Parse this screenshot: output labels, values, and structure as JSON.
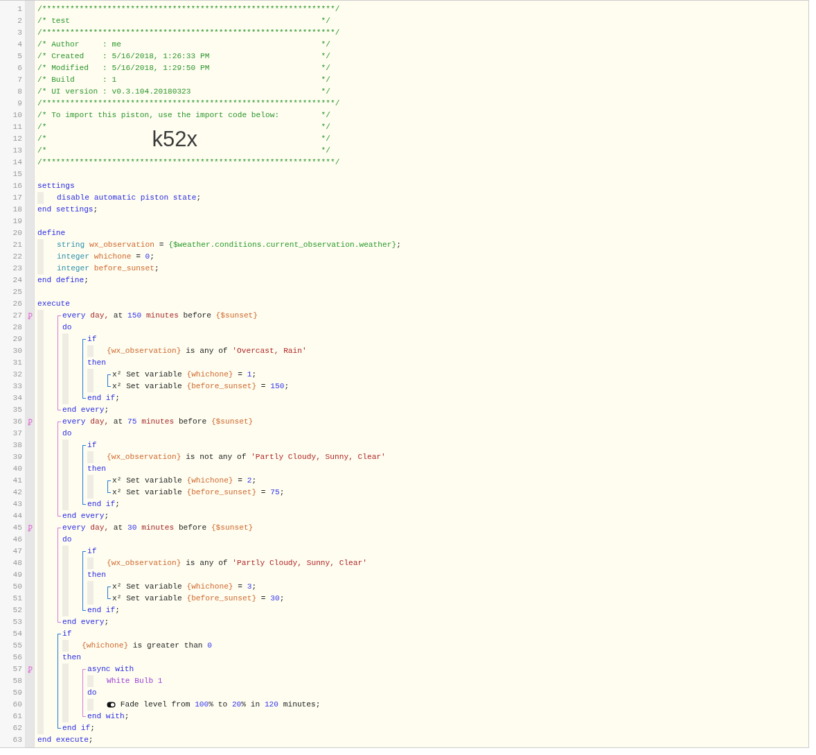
{
  "code": [
    {
      "kind": "line",
      "number": "1",
      "tokens": [
        {
          "kind": "comment",
          "text": "/***************************************************************/"
        }
      ]
    },
    {
      "kind": "line",
      "number": "2",
      "tokens": [
        {
          "kind": "comment",
          "text": "/* test"
        },
        {
          "kind": "comment-end",
          "text": "*/"
        }
      ]
    },
    {
      "kind": "line",
      "number": "3",
      "tokens": [
        {
          "kind": "comment",
          "text": "/***************************************************************/"
        }
      ]
    },
    {
      "kind": "line",
      "number": "4",
      "tokens": [
        {
          "kind": "comment",
          "text": "/* Author     : me"
        },
        {
          "kind": "comment-end",
          "text": "*/"
        }
      ]
    },
    {
      "kind": "line",
      "number": "5",
      "tokens": [
        {
          "kind": "comment",
          "text": "/* Created    : 5/16/2018, 1:26:33 PM"
        },
        {
          "kind": "comment-end",
          "text": "*/"
        }
      ]
    },
    {
      "kind": "line",
      "number": "6",
      "tokens": [
        {
          "kind": "comment",
          "text": "/* Modified   : 5/16/2018, 1:29:50 PM"
        },
        {
          "kind": "comment-end",
          "text": "*/"
        }
      ]
    },
    {
      "kind": "line",
      "number": "7",
      "tokens": [
        {
          "kind": "comment",
          "text": "/* Build      : 1"
        },
        {
          "kind": "comment-end",
          "text": "*/"
        }
      ]
    },
    {
      "kind": "line",
      "number": "8",
      "tokens": [
        {
          "kind": "comment",
          "text": "/* UI version : v0.3.104.20180323"
        },
        {
          "kind": "comment-end",
          "text": "*/"
        }
      ]
    },
    {
      "kind": "line",
      "number": "9",
      "tokens": [
        {
          "kind": "comment",
          "text": "/***************************************************************/"
        }
      ]
    },
    {
      "kind": "line",
      "number": "10",
      "tokens": [
        {
          "kind": "comment",
          "text": "/* To import this piston, use the import code below:"
        },
        {
          "kind": "comment-end",
          "text": "*/"
        }
      ]
    },
    {
      "kind": "line",
      "number": "11",
      "tokens": [
        {
          "kind": "comment",
          "text": "/*"
        },
        {
          "kind": "comment-end",
          "text": "*/"
        }
      ]
    },
    {
      "kind": "line",
      "number": "12",
      "tokens": [
        {
          "kind": "comment",
          "text": "/*"
        },
        {
          "kind": "import-code",
          "text": "k52x"
        },
        {
          "kind": "comment-end",
          "text": "*/"
        }
      ]
    },
    {
      "kind": "line",
      "number": "13",
      "tokens": [
        {
          "kind": "comment",
          "text": "/*"
        },
        {
          "kind": "comment-end",
          "text": "*/"
        }
      ]
    },
    {
      "kind": "line",
      "number": "14",
      "tokens": [
        {
          "kind": "comment",
          "text": "/***************************************************************/"
        }
      ]
    },
    {
      "kind": "line",
      "number": "15"
    },
    {
      "kind": "line",
      "number": "16",
      "tokens": [
        {
          "kind": "keyword",
          "text": "settings"
        }
      ],
      "children": [
        {
          "kind": "line",
          "number": "17",
          "tokens": [
            {
              "kind": "keyword",
              "text": "disable automatic piston state"
            },
            {
              "kind": "plain",
              "text": ";"
            }
          ]
        }
      ]
    },
    {
      "kind": "line",
      "number": "18",
      "tokens": [
        {
          "kind": "keyword",
          "text": "end settings"
        },
        {
          "kind": "plain",
          "text": ";"
        }
      ]
    },
    {
      "kind": "line",
      "number": "19"
    },
    {
      "kind": "line",
      "number": "20",
      "tokens": [
        {
          "kind": "keyword",
          "text": "define"
        }
      ],
      "children": [
        {
          "kind": "line",
          "number": "21",
          "tokens": [
            {
              "kind": "type",
              "text": "string"
            },
            {
              "kind": "variable",
              "text": " wx_observation"
            },
            {
              "kind": "plain",
              "text": " = "
            },
            {
              "kind": "expression",
              "text": "{$weather.conditions.current_observation.weather}"
            },
            {
              "kind": "plain",
              "text": ";"
            }
          ]
        },
        {
          "kind": "line",
          "number": "22",
          "tokens": [
            {
              "kind": "type",
              "text": "integer"
            },
            {
              "kind": "variable",
              "text": " whichone"
            },
            {
              "kind": "plain",
              "text": " = "
            },
            {
              "kind": "number",
              "text": "0"
            },
            {
              "kind": "plain",
              "text": ";"
            }
          ]
        },
        {
          "kind": "line",
          "number": "23",
          "tokens": [
            {
              "kind": "type",
              "text": "integer"
            },
            {
              "kind": "variable",
              "text": " before_sunset"
            },
            {
              "kind": "plain",
              "text": ";"
            }
          ]
        }
      ]
    },
    {
      "kind": "line",
      "number": "24",
      "tokens": [
        {
          "kind": "keyword",
          "text": "end define"
        },
        {
          "kind": "plain",
          "text": ";"
        }
      ]
    },
    {
      "kind": "line",
      "number": "25"
    },
    {
      "kind": "line",
      "number": "26",
      "tokens": [
        {
          "kind": "keyword",
          "text": "execute"
        }
      ],
      "children": [
        {
          "kind": "block",
          "color": "#d67ad9",
          "items": [
            {
              "kind": "line",
              "number": "27",
              "marker": true,
              "tokens": [
                {
                  "kind": "keyword",
                  "text": "every"
                },
                {
                  "kind": "unit",
                  "text": " day,"
                },
                {
                  "kind": "plain",
                  "text": " at "
                },
                {
                  "kind": "number",
                  "text": "150"
                },
                {
                  "kind": "unit",
                  "text": " minutes"
                },
                {
                  "kind": "plain",
                  "text": " before "
                },
                {
                  "kind": "variable",
                  "text": "{$sunset}"
                }
              ]
            },
            {
              "kind": "line",
              "number": "28",
              "tokens": [
                {
                  "kind": "keyword",
                  "text": "do"
                }
              ],
              "children": [
                {
                  "kind": "block",
                  "color": "#1f7ad8",
                  "items": [
                    {
                      "kind": "line",
                      "number": "29",
                      "tokens": [
                        {
                          "kind": "keyword",
                          "text": "if"
                        }
                      ],
                      "children": [
                        {
                          "kind": "line",
                          "number": "30",
                          "tokens": [
                            {
                              "kind": "variable",
                              "text": "{wx_observation}"
                            },
                            {
                              "kind": "plain",
                              "text": " is any of "
                            },
                            {
                              "kind": "string",
                              "text": "'Overcast, Rain'"
                            }
                          ]
                        }
                      ]
                    },
                    {
                      "kind": "line",
                      "number": "31",
                      "tokens": [
                        {
                          "kind": "keyword",
                          "text": "then"
                        }
                      ],
                      "children": [
                        {
                          "kind": "block",
                          "color": "#1f7ad8",
                          "items": [
                            {
                              "kind": "line",
                              "number": "32",
                              "tokens": [
                                {
                                  "kind": "plain",
                                  "text": "x² Set variable "
                                },
                                {
                                  "kind": "variable",
                                  "text": "{whichone}"
                                },
                                {
                                  "kind": "plain",
                                  "text": " = "
                                },
                                {
                                  "kind": "number",
                                  "text": "1"
                                },
                                {
                                  "kind": "plain",
                                  "text": ";"
                                }
                              ]
                            },
                            {
                              "kind": "line",
                              "number": "33",
                              "tokens": [
                                {
                                  "kind": "plain",
                                  "text": "x² Set variable "
                                },
                                {
                                  "kind": "variable",
                                  "text": "{before_sunset}"
                                },
                                {
                                  "kind": "plain",
                                  "text": " = "
                                },
                                {
                                  "kind": "number",
                                  "text": "150"
                                },
                                {
                                  "kind": "plain",
                                  "text": ";"
                                }
                              ]
                            }
                          ]
                        }
                      ]
                    },
                    {
                      "kind": "line",
                      "number": "34",
                      "tokens": [
                        {
                          "kind": "keyword",
                          "text": "end if"
                        },
                        {
                          "kind": "plain",
                          "text": ";"
                        }
                      ]
                    }
                  ]
                }
              ]
            },
            {
              "kind": "line",
              "number": "35",
              "tokens": [
                {
                  "kind": "keyword",
                  "text": "end every"
                },
                {
                  "kind": "plain",
                  "text": ";"
                }
              ]
            }
          ]
        },
        {
          "kind": "block",
          "color": "#d67ad9",
          "items": [
            {
              "kind": "line",
              "number": "36",
              "marker": true,
              "tokens": [
                {
                  "kind": "keyword",
                  "text": "every"
                },
                {
                  "kind": "unit",
                  "text": " day,"
                },
                {
                  "kind": "plain",
                  "text": " at "
                },
                {
                  "kind": "number",
                  "text": "75"
                },
                {
                  "kind": "unit",
                  "text": " minutes"
                },
                {
                  "kind": "plain",
                  "text": " before "
                },
                {
                  "kind": "variable",
                  "text": "{$sunset}"
                }
              ]
            },
            {
              "kind": "line",
              "number": "37",
              "tokens": [
                {
                  "kind": "keyword",
                  "text": "do"
                }
              ],
              "children": [
                {
                  "kind": "block",
                  "color": "#1f7ad8",
                  "items": [
                    {
                      "kind": "line",
                      "number": "38",
                      "tokens": [
                        {
                          "kind": "keyword",
                          "text": "if"
                        }
                      ],
                      "children": [
                        {
                          "kind": "line",
                          "number": "39",
                          "tokens": [
                            {
                              "kind": "variable",
                              "text": "{wx_observation}"
                            },
                            {
                              "kind": "plain",
                              "text": " is not any of "
                            },
                            {
                              "kind": "string",
                              "text": "'Partly Cloudy, Sunny, Clear'"
                            }
                          ]
                        }
                      ]
                    },
                    {
                      "kind": "line",
                      "number": "40",
                      "tokens": [
                        {
                          "kind": "keyword",
                          "text": "then"
                        }
                      ],
                      "children": [
                        {
                          "kind": "block",
                          "color": "#1f7ad8",
                          "items": [
                            {
                              "kind": "line",
                              "number": "41",
                              "tokens": [
                                {
                                  "kind": "plain",
                                  "text": "x² Set variable "
                                },
                                {
                                  "kind": "variable",
                                  "text": "{whichone}"
                                },
                                {
                                  "kind": "plain",
                                  "text": " = "
                                },
                                {
                                  "kind": "number",
                                  "text": "2"
                                },
                                {
                                  "kind": "plain",
                                  "text": ";"
                                }
                              ]
                            },
                            {
                              "kind": "line",
                              "number": "42",
                              "tokens": [
                                {
                                  "kind": "plain",
                                  "text": "x² Set variable "
                                },
                                {
                                  "kind": "variable",
                                  "text": "{before_sunset}"
                                },
                                {
                                  "kind": "plain",
                                  "text": " = "
                                },
                                {
                                  "kind": "number",
                                  "text": "75"
                                },
                                {
                                  "kind": "plain",
                                  "text": ";"
                                }
                              ]
                            }
                          ]
                        }
                      ]
                    },
                    {
                      "kind": "line",
                      "number": "43",
                      "tokens": [
                        {
                          "kind": "keyword",
                          "text": "end if"
                        },
                        {
                          "kind": "plain",
                          "text": ";"
                        }
                      ]
                    }
                  ]
                }
              ]
            },
            {
              "kind": "line",
              "number": "44",
              "tokens": [
                {
                  "kind": "keyword",
                  "text": "end every"
                },
                {
                  "kind": "plain",
                  "text": ";"
                }
              ]
            }
          ]
        },
        {
          "kind": "block",
          "color": "#d67ad9",
          "items": [
            {
              "kind": "line",
              "number": "45",
              "marker": true,
              "tokens": [
                {
                  "kind": "keyword",
                  "text": "every"
                },
                {
                  "kind": "unit",
                  "text": " day,"
                },
                {
                  "kind": "plain",
                  "text": " at "
                },
                {
                  "kind": "number",
                  "text": "30"
                },
                {
                  "kind": "unit",
                  "text": " minutes"
                },
                {
                  "kind": "plain",
                  "text": " before "
                },
                {
                  "kind": "variable",
                  "text": "{$sunset}"
                }
              ]
            },
            {
              "kind": "line",
              "number": "46",
              "tokens": [
                {
                  "kind": "keyword",
                  "text": "do"
                }
              ],
              "children": [
                {
                  "kind": "block",
                  "color": "#1f7ad8",
                  "items": [
                    {
                      "kind": "line",
                      "number": "47",
                      "tokens": [
                        {
                          "kind": "keyword",
                          "text": "if"
                        }
                      ],
                      "children": [
                        {
                          "kind": "line",
                          "number": "48",
                          "tokens": [
                            {
                              "kind": "variable",
                              "text": "{wx_observation}"
                            },
                            {
                              "kind": "plain",
                              "text": " is any of "
                            },
                            {
                              "kind": "string",
                              "text": "'Partly Cloudy, Sunny, Clear'"
                            }
                          ]
                        }
                      ]
                    },
                    {
                      "kind": "line",
                      "number": "49",
                      "tokens": [
                        {
                          "kind": "keyword",
                          "text": "then"
                        }
                      ],
                      "children": [
                        {
                          "kind": "block",
                          "color": "#1f7ad8",
                          "items": [
                            {
                              "kind": "line",
                              "number": "50",
                              "tokens": [
                                {
                                  "kind": "plain",
                                  "text": "x² Set variable "
                                },
                                {
                                  "kind": "variable",
                                  "text": "{whichone}"
                                },
                                {
                                  "kind": "plain",
                                  "text": " = "
                                },
                                {
                                  "kind": "number",
                                  "text": "3"
                                },
                                {
                                  "kind": "plain",
                                  "text": ";"
                                }
                              ]
                            },
                            {
                              "kind": "line",
                              "number": "51",
                              "tokens": [
                                {
                                  "kind": "plain",
                                  "text": "x² Set variable "
                                },
                                {
                                  "kind": "variable",
                                  "text": "{before_sunset}"
                                },
                                {
                                  "kind": "plain",
                                  "text": " = "
                                },
                                {
                                  "kind": "number",
                                  "text": "30"
                                },
                                {
                                  "kind": "plain",
                                  "text": ";"
                                }
                              ]
                            }
                          ]
                        }
                      ]
                    },
                    {
                      "kind": "line",
                      "number": "52",
                      "tokens": [
                        {
                          "kind": "keyword",
                          "text": "end if"
                        },
                        {
                          "kind": "plain",
                          "text": ";"
                        }
                      ]
                    }
                  ]
                }
              ]
            },
            {
              "kind": "line",
              "number": "53",
              "tokens": [
                {
                  "kind": "keyword",
                  "text": "end every"
                },
                {
                  "kind": "plain",
                  "text": ";"
                }
              ]
            }
          ]
        },
        {
          "kind": "block",
          "color": "#1f7ad8",
          "items": [
            {
              "kind": "line",
              "number": "54",
              "tokens": [
                {
                  "kind": "keyword",
                  "text": "if"
                }
              ],
              "children": [
                {
                  "kind": "line",
                  "number": "55",
                  "tokens": [
                    {
                      "kind": "variable",
                      "text": "{whichone}"
                    },
                    {
                      "kind": "plain",
                      "text": " is greater than "
                    },
                    {
                      "kind": "number",
                      "text": "0"
                    }
                  ]
                }
              ]
            },
            {
              "kind": "line",
              "number": "56",
              "tokens": [
                {
                  "kind": "keyword",
                  "text": "then"
                }
              ],
              "children": [
                {
                  "kind": "block",
                  "color": "#d67ad9",
                  "items": [
                    {
                      "kind": "line",
                      "number": "57",
                      "marker": true,
                      "tokens": [
                        {
                          "kind": "keyword",
                          "text": "async with"
                        }
                      ],
                      "children": [
                        {
                          "kind": "line",
                          "number": "58",
                          "tokens": [
                            {
                              "kind": "device",
                              "text": "White Bulb 1"
                            }
                          ]
                        }
                      ]
                    },
                    {
                      "kind": "line",
                      "number": "59",
                      "tokens": [
                        {
                          "kind": "keyword",
                          "text": "do"
                        }
                      ],
                      "children": [
                        {
                          "kind": "line",
                          "number": "60",
                          "tokens": [
                            {
                              "kind": "toggle"
                            },
                            {
                              "kind": "plain",
                              "text": " Fade level from "
                            },
                            {
                              "kind": "number",
                              "text": "100"
                            },
                            {
                              "kind": "plain",
                              "text": "% to "
                            },
                            {
                              "kind": "number",
                              "text": "20"
                            },
                            {
                              "kind": "plain",
                              "text": "% in "
                            },
                            {
                              "kind": "number",
                              "text": "120"
                            },
                            {
                              "kind": "plain",
                              "text": " minutes;"
                            }
                          ]
                        }
                      ]
                    },
                    {
                      "kind": "line",
                      "number": "61",
                      "tokens": [
                        {
                          "kind": "keyword",
                          "text": "end with"
                        },
                        {
                          "kind": "plain",
                          "text": ";"
                        }
                      ]
                    }
                  ]
                }
              ]
            },
            {
              "kind": "line",
              "number": "62",
              "tokens": [
                {
                  "kind": "keyword",
                  "text": "end if"
                },
                {
                  "kind": "plain",
                  "text": ";"
                }
              ]
            }
          ]
        }
      ]
    },
    {
      "kind": "line",
      "number": "63",
      "tokens": [
        {
          "kind": "keyword",
          "text": "end execute"
        },
        {
          "kind": "plain",
          "text": ";"
        }
      ]
    }
  ]
}
